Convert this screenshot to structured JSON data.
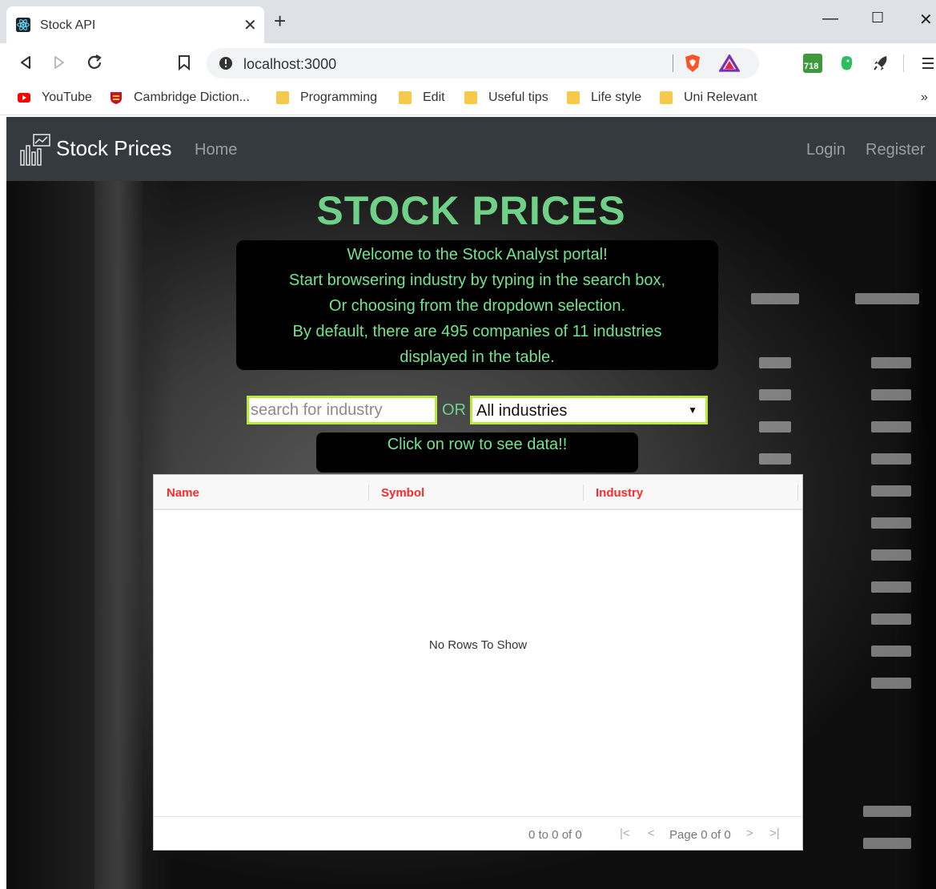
{
  "browser": {
    "tab_title": "Stock API",
    "url": "localhost:3000",
    "bookmarks": [
      {
        "label": "YouTube",
        "icon": "youtube-icon"
      },
      {
        "label": "Cambridge Diction...",
        "icon": "cambridge-icon"
      },
      {
        "label": "Programming",
        "icon": "folder-icon"
      },
      {
        "label": "Edit",
        "icon": "folder-icon"
      },
      {
        "label": "Useful tips",
        "icon": "folder-icon"
      },
      {
        "label": "Life style",
        "icon": "folder-icon"
      },
      {
        "label": "Uni Relevant",
        "icon": "folder-icon"
      }
    ],
    "bookmarks_more": "»",
    "extension_badge": "718"
  },
  "navbar": {
    "brand": "Stock Prices",
    "home": "Home",
    "login": "Login",
    "register": "Register"
  },
  "hero": {
    "title": "STOCK PRICES",
    "welcome_lines": [
      "Welcome to the Stock Analyst portal!",
      "Start browsering industry by typing in the search box,",
      "Or choosing from the dropdown selection.",
      "By default, there are 495 companies of 11 industries",
      "displayed in the table."
    ]
  },
  "filters": {
    "search_placeholder": "search for industry",
    "or_label": "OR",
    "selected_industry": "All industries"
  },
  "hint": "Click on row to see data!!",
  "grid": {
    "columns": [
      "Name",
      "Symbol",
      "Industry"
    ],
    "empty_message": "No Rows To Show",
    "row_count_text": "0 to 0 of 0",
    "page_text": "Page 0 of 0"
  },
  "colors": {
    "accent_green": "#6fd087",
    "header_red": "#ff2a2a",
    "navbar": "#343a40",
    "input_border": "#b7ea3a"
  }
}
